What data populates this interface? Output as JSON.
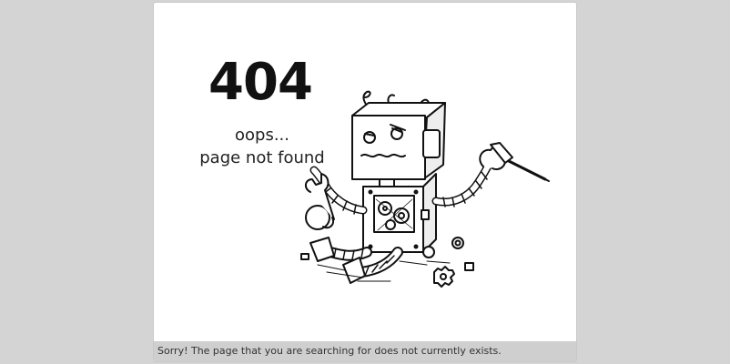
{
  "error": {
    "code": "404",
    "line1": "oops...",
    "line2": "page not found"
  },
  "illustration": {
    "icon": "broken-robot-icon"
  },
  "footer": {
    "text": "Sorry! The page that you are searching for does not currently exists."
  }
}
